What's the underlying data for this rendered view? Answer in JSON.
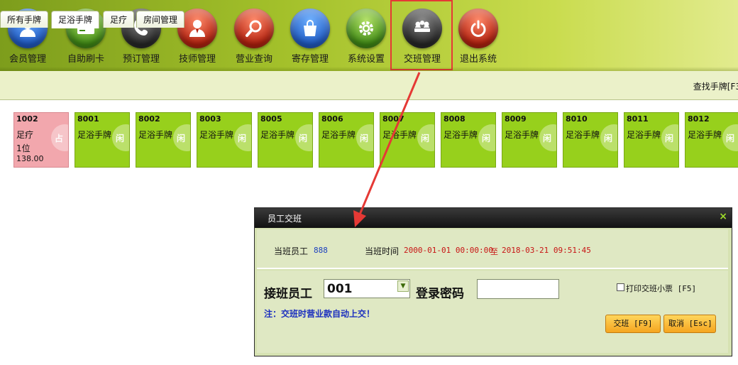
{
  "toolbar": {
    "items": [
      {
        "label": "会员管理",
        "icon": "member-icon",
        "color": "#2d6fd3"
      },
      {
        "label": "自助刷卡",
        "icon": "card-icon",
        "color": "#4a9a1e"
      },
      {
        "label": "预订管理",
        "icon": "phone-icon",
        "color": "#3a3a3a"
      },
      {
        "label": "技师管理",
        "icon": "technician-icon",
        "color": "#c8321e"
      },
      {
        "label": "营业查询",
        "icon": "search-icon",
        "color": "#c8321e"
      },
      {
        "label": "寄存管理",
        "icon": "bag-icon",
        "color": "#2d6fd3"
      },
      {
        "label": "系统设置",
        "icon": "gear-icon",
        "color": "#4a9a1e"
      },
      {
        "label": "交班管理",
        "icon": "shift-icon",
        "color": "#3a3a3a"
      },
      {
        "label": "退出系统",
        "icon": "power-icon",
        "color": "#c8321e"
      }
    ]
  },
  "tabs": [
    {
      "label": "所有手牌",
      "active": false
    },
    {
      "label": "足浴手牌",
      "active": true
    },
    {
      "label": "足疗",
      "active": false
    },
    {
      "label": "房间管理",
      "active": false
    }
  ],
  "find_label": "查找手牌[F3",
  "cards": [
    {
      "num": "1002",
      "type": "足疗",
      "line3": "1位",
      "line4": "138.00",
      "status": "occupied",
      "badge": "占"
    },
    {
      "num": "8001",
      "type": "足浴手牌",
      "status": "free",
      "badge": "闲"
    },
    {
      "num": "8002",
      "type": "足浴手牌",
      "status": "free",
      "badge": "闲"
    },
    {
      "num": "8003",
      "type": "足浴手牌",
      "status": "free",
      "badge": "闲"
    },
    {
      "num": "8005",
      "type": "足浴手牌",
      "status": "free",
      "badge": "闲"
    },
    {
      "num": "8006",
      "type": "足浴手牌",
      "status": "free",
      "badge": "闲"
    },
    {
      "num": "8007",
      "type": "足浴手牌",
      "status": "free",
      "badge": "闲"
    },
    {
      "num": "8008",
      "type": "足浴手牌",
      "status": "free",
      "badge": "闲"
    },
    {
      "num": "8009",
      "type": "足浴手牌",
      "status": "free",
      "badge": "闲"
    },
    {
      "num": "8010",
      "type": "足浴手牌",
      "status": "free",
      "badge": "闲"
    },
    {
      "num": "8011",
      "type": "足浴手牌",
      "status": "free",
      "badge": "闲"
    },
    {
      "num": "8012",
      "type": "足浴手牌",
      "status": "free",
      "badge": "闲"
    }
  ],
  "dialog": {
    "title": "员工交班",
    "close": "×",
    "duty_staff_label": "当班员工",
    "duty_staff_value": "888",
    "duty_time_label": "当班时间",
    "time_start": "2000-01-01 00:00:00",
    "time_sep": "至",
    "time_end": "2018-03-21 09:51:45",
    "receiver_label": "接班员工",
    "receiver_value": "001",
    "password_label": "登录密码",
    "password_value": "",
    "print_label": "打印交班小票 [F5]",
    "note": "注：交班时营业款自动上交！",
    "confirm_label": "交班 [F9]",
    "cancel_label": "取消 [Esc]"
  },
  "colors": {
    "free_card": "#97d01c",
    "occupied_card": "#f2a7ad",
    "highlight": "#e53935"
  }
}
